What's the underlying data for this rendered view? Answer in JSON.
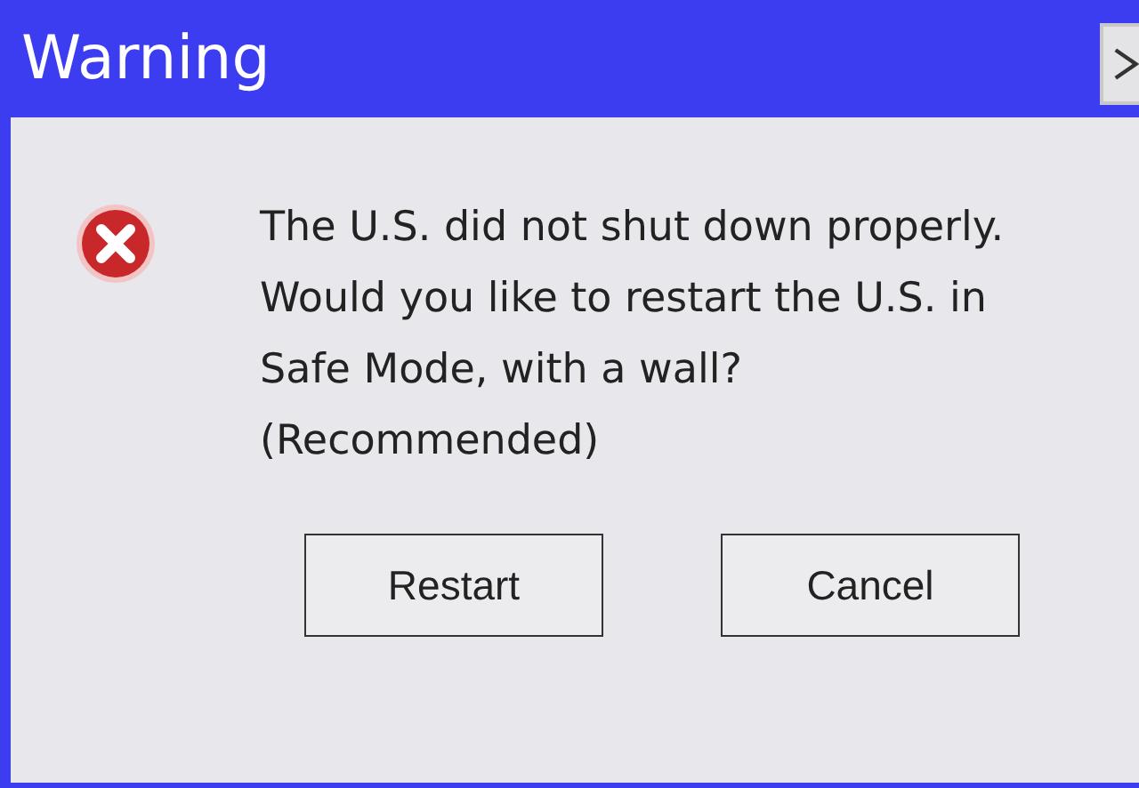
{
  "window": {
    "title": "Warning"
  },
  "message": {
    "lines": [
      "The U.S. did not shut down properly.",
      "Would you like to restart the U.S. in",
      "Safe Mode, with a wall?",
      "(Recommended)"
    ]
  },
  "buttons": [
    "Restart",
    "Cancel"
  ]
}
